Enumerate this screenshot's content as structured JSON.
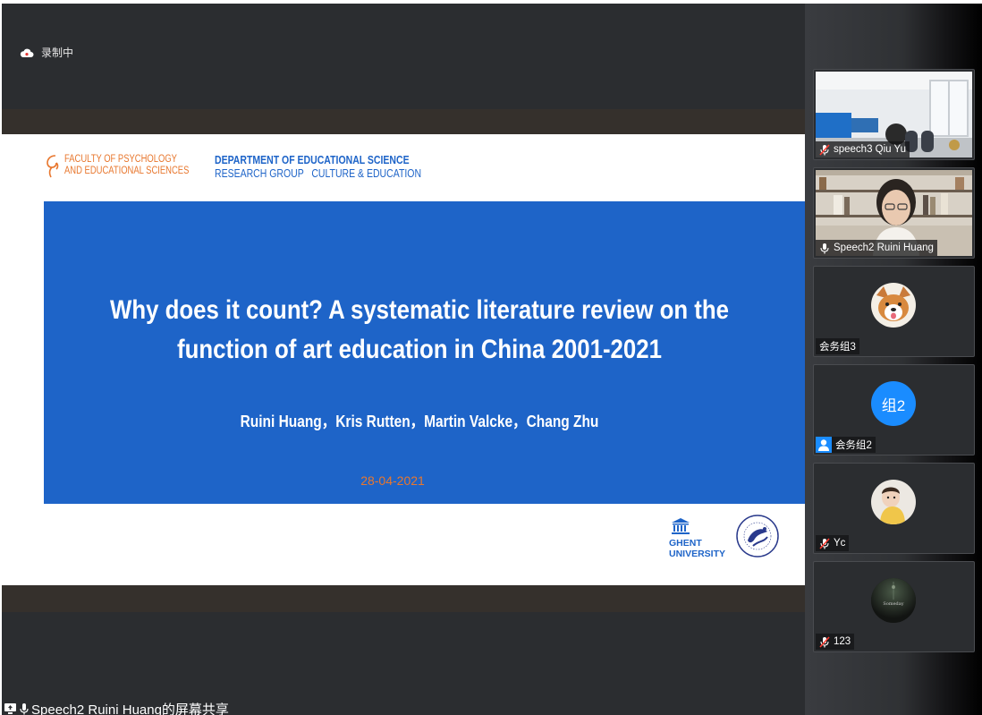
{
  "recording": {
    "label": "录制中"
  },
  "slide": {
    "faculty_line1": "FACULTY OF PSYCHOLOGY",
    "faculty_line2": "AND EDUCATIONAL SCIENCES",
    "dept_line1": "DEPARTMENT OF EDUCATIONAL SCIENCE",
    "dept_line2": "RESEARCH GROUP   CULTURE & EDUCATION",
    "title_line1": "Why does it count? A systematic literature review on the",
    "title_line2": "function of art education in China 2001-2021",
    "authors": "Ruini Huang，Kris Rutten，Martin Valcke，Chang Zhu",
    "date": "28-04-2021",
    "ghent_line1": "GHENT",
    "ghent_line2": "UNIVERSITY"
  },
  "share": {
    "label": "Speech2 Ruini Huang的屏幕共享"
  },
  "participants": [
    {
      "name": "speech3 Qiu Yu",
      "mic_icon": "mic-muted-icon",
      "kind": "video"
    },
    {
      "name": "Speech2 Ruini Huang",
      "mic_icon": "mic-icon",
      "kind": "video"
    },
    {
      "name": "会务组3",
      "mic_icon": "none",
      "kind": "avatar"
    },
    {
      "name": "会务组2",
      "mic_icon": "user-icon",
      "kind": "text-avatar",
      "avatar_text": "组2"
    },
    {
      "name": "Yc",
      "mic_icon": "mic-muted-icon",
      "kind": "avatar"
    },
    {
      "name": "123",
      "mic_icon": "mic-muted-icon",
      "kind": "avatar",
      "avatar_text": "Someday"
    }
  ],
  "colors": {
    "ugent_blue": "#1e64c8",
    "ugent_orange": "#e8772e",
    "avatar_blue": "#1a8cff"
  }
}
